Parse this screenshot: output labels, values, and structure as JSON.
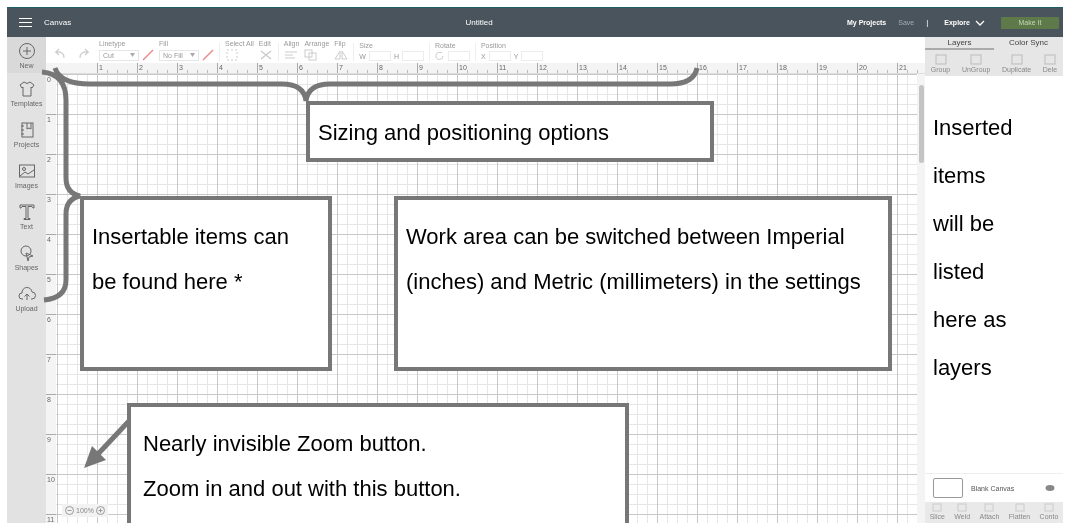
{
  "header": {
    "title": "Canvas",
    "document": "Untitled",
    "links": [
      {
        "label": "My Projects",
        "disabled": false
      },
      {
        "label": "Save",
        "disabled": true
      }
    ],
    "separator": "|",
    "explore": "Explore",
    "make_button": "Make It"
  },
  "sidebar": [
    {
      "label": "New",
      "kind": "plus",
      "selected": true
    },
    {
      "label": "Templates",
      "kind": "shirt",
      "selected": false
    },
    {
      "label": "Projects",
      "kind": "book",
      "selected": false
    },
    {
      "label": "Images",
      "kind": "image",
      "selected": false
    },
    {
      "label": "Text",
      "kind": "text",
      "selected": false
    },
    {
      "label": "Shapes",
      "kind": "shapes",
      "selected": false
    },
    {
      "label": "Upload",
      "kind": "upload",
      "selected": false
    }
  ],
  "toolbar": {
    "linetype_label": "Linetype",
    "linetype_value": "Cut",
    "fill_label": "Fill",
    "fill_value": "No Fill",
    "select_all": "Select All",
    "edit": "Edit",
    "align": "Align",
    "arrange": "Arrange",
    "flip": "Flip",
    "size": "Size",
    "w": "W",
    "h": "H",
    "rotate": "Rotate",
    "position": "Position",
    "x": "X",
    "y": "Y"
  },
  "ruler": {
    "horizontal": [
      "1",
      "2",
      "3",
      "4",
      "5",
      "6",
      "7",
      "8",
      "9",
      "10",
      "11",
      "12",
      "13",
      "14",
      "15",
      "16",
      "17",
      "18",
      "19",
      "20",
      "21"
    ],
    "vertical": [
      "0",
      "1",
      "2",
      "3",
      "4",
      "5",
      "6",
      "7",
      "8",
      "9",
      "10",
      "11"
    ]
  },
  "zoom": {
    "value": "100%"
  },
  "layers_panel": {
    "tabs": [
      {
        "label": "Layers",
        "selected": true
      },
      {
        "label": "Color Sync",
        "selected": false
      }
    ],
    "actions": [
      "Group",
      "UnGroup",
      "Duplicate",
      "Dele"
    ],
    "layer": "Blank Canvas",
    "bottom_actions": [
      "Slice",
      "Weld",
      "Attach",
      "Flatten",
      "Conto"
    ]
  },
  "annotations": [
    {
      "paragraphs": [
        "Sizing and positioning options"
      ]
    },
    {
      "paragraphs": [
        "Insertable items can be found here *"
      ]
    },
    {
      "paragraphs": [
        "Work area can be switched between Imperial (inches) and Metric (millimeters) in the settings"
      ]
    },
    {
      "paragraphs": [
        "Nearly invisible Zoom button.",
        "Zoom in and out with this button."
      ]
    }
  ],
  "side_note": "Inserted items will be listed here as layers"
}
